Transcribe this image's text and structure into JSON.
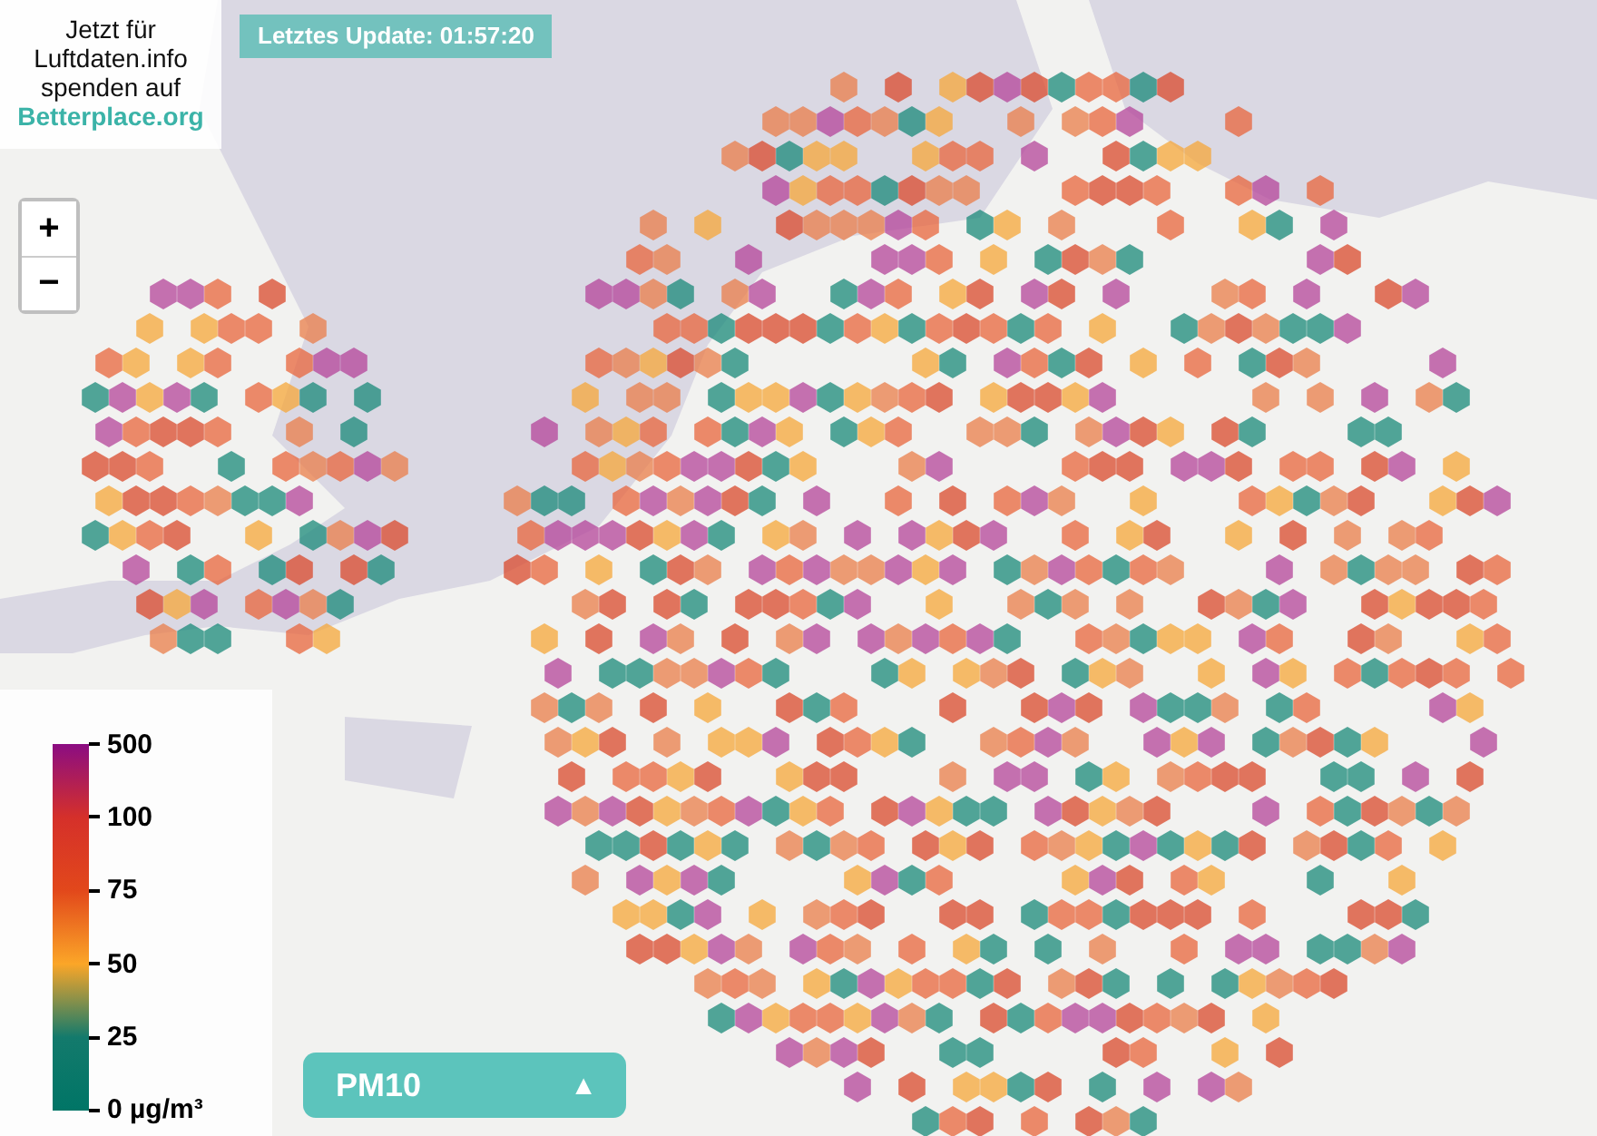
{
  "donate": {
    "text": "Jetzt für Luftdaten.info spenden auf",
    "link": "Betterplace.org"
  },
  "update_badge": {
    "text": "Letztes Update: 01:57:20"
  },
  "zoom_controls": [
    {
      "label": "+"
    },
    {
      "label": "−"
    }
  ],
  "legend": {
    "labels": [
      "500",
      "100",
      "75",
      "50",
      "25",
      "0 µg/m³"
    ]
  },
  "pollutant_selector": {
    "value": "PM10",
    "arrow": "▲"
  }
}
